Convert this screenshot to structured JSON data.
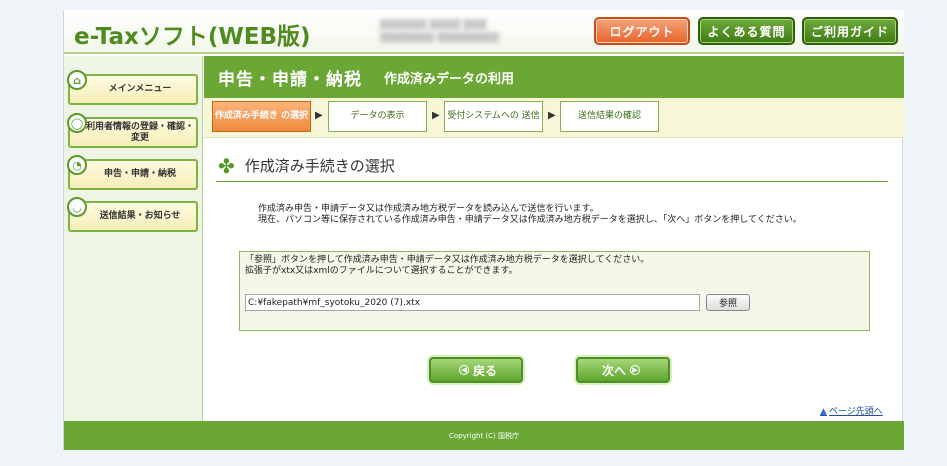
{
  "header": {
    "logo": "e-Taxソフト(WEB版)",
    "buttons": {
      "logout": "ログアウト",
      "faq": "よくある質問",
      "guide": "ご利用ガイド"
    }
  },
  "sidebar": {
    "items": [
      {
        "label": "メインメニュー",
        "icon": "home-icon"
      },
      {
        "label": "利用者情報の登録・確認・変更",
        "icon": "user-icon"
      },
      {
        "label": "申告・申請・納税",
        "icon": "document-icon"
      },
      {
        "label": "送信結果・お知らせ",
        "icon": "mail-icon"
      }
    ]
  },
  "titlebar": {
    "main": "申告・申請・納税",
    "sub": "作成済みデータの利用"
  },
  "steps": [
    {
      "label": "作成済み手続き の選択",
      "active": true
    },
    {
      "label": "データの表示",
      "active": false
    },
    {
      "label": "受付システムへの 送信",
      "active": false
    },
    {
      "label": "送信結果の確認",
      "active": false
    }
  ],
  "section": {
    "title": "作成済み手続きの選択"
  },
  "description": {
    "line1": "作成済み申告・申請データ又は作成済み地方税データを読み込んで送信を行います。",
    "line2": "現在、パソコン等に保存されている作成済み申告・申請データ又は作成済み地方税データを選択し、「次へ」ボタンを押してください。"
  },
  "panel": {
    "line1": "「参照」ボタンを押して作成済み申告・申請データ又は作成済み地方税データを選択してください。",
    "line2": "拡張子がxtx又はxmlのファイルについて選択することができます。",
    "file_value": "C:¥fakepath¥mf_syotoku_2020 (7).xtx",
    "browse_label": "参照"
  },
  "nav": {
    "back": "戻る",
    "next": "次へ"
  },
  "page_top": "ページ先頭へ",
  "footer": "Copyright (C) 国税庁",
  "colors": {
    "brand_green": "#6aa734",
    "logout_orange": "#e8632a"
  }
}
